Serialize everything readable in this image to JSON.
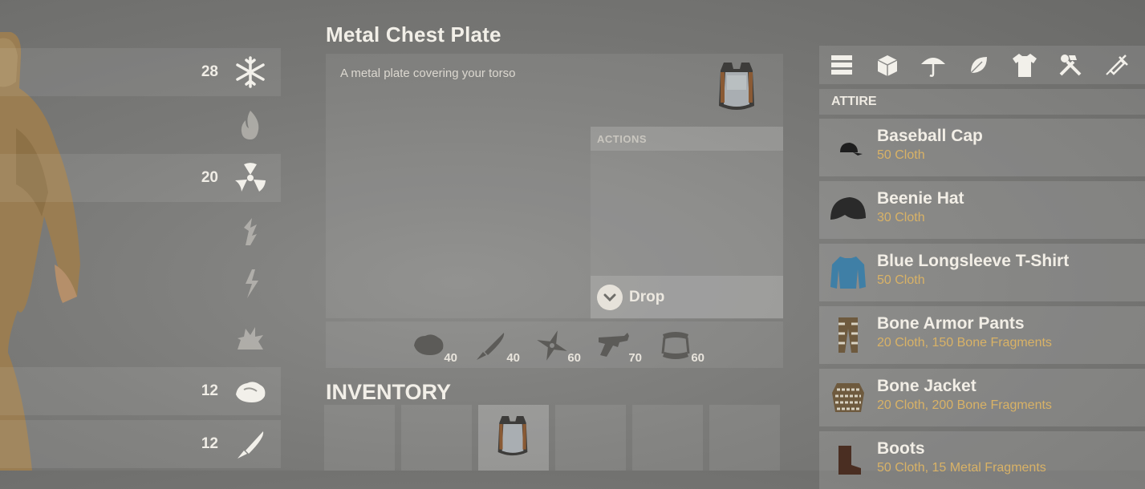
{
  "stats": [
    {
      "value": "28",
      "icon": "snowflake-icon",
      "filled": true
    },
    {
      "value": "",
      "icon": "fire-icon",
      "filled": false
    },
    {
      "value": "20",
      "icon": "radiation-icon",
      "filled": true
    },
    {
      "value": "",
      "icon": "bleed-icon",
      "filled": false
    },
    {
      "value": "",
      "icon": "lightning-icon",
      "filled": false
    },
    {
      "value": "",
      "icon": "explosion-icon",
      "filled": false
    },
    {
      "value": "12",
      "icon": "rock-icon",
      "filled": true
    },
    {
      "value": "12",
      "icon": "knife-icon",
      "filled": true
    }
  ],
  "item": {
    "title": "Metal Chest Plate",
    "description": "A metal plate covering your torso",
    "actions_header": "ACTIONS",
    "drop_label": "Drop",
    "protections": [
      {
        "icon": "rock-icon",
        "value": "40"
      },
      {
        "icon": "blade-icon",
        "value": "40"
      },
      {
        "icon": "shuriken-icon",
        "value": "60"
      },
      {
        "icon": "revolver-icon",
        "value": "70"
      },
      {
        "icon": "bite-icon",
        "value": "60"
      }
    ]
  },
  "inventory": {
    "title": "INVENTORY"
  },
  "crafting": {
    "categories": [
      "storage-icon",
      "block-icon",
      "umbrella-icon",
      "leaf-icon",
      "shirt-icon",
      "tools-icon",
      "syringe-icon"
    ],
    "section_header": "ATTIRE",
    "recipes": [
      {
        "name": "Baseball Cap",
        "cost": "50 Cloth"
      },
      {
        "name": "Beenie Hat",
        "cost": "30 Cloth"
      },
      {
        "name": "Blue Longsleeve T-Shirt",
        "cost": "50 Cloth"
      },
      {
        "name": "Bone Armor Pants",
        "cost": "20 Cloth, 150 Bone Fragments"
      },
      {
        "name": "Bone Jacket",
        "cost": "20 Cloth, 200 Bone Fragments"
      },
      {
        "name": "Boots",
        "cost": "50 Cloth, 15 Metal Fragments"
      }
    ]
  }
}
